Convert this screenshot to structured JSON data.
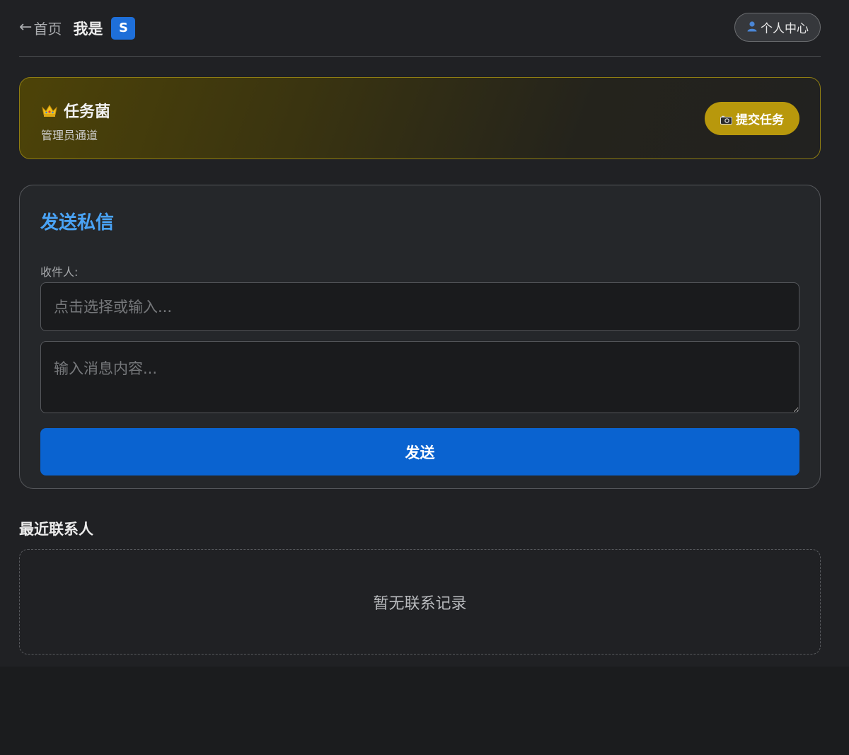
{
  "header": {
    "back_arrow": "←",
    "back_label": "首页",
    "me_label": "我是",
    "avatar_letter": "S",
    "user_center_label": "个人中心",
    "user_center_icon": "person-icon"
  },
  "task_banner": {
    "icon": "crown-icon",
    "title": "任务菌",
    "subtitle": "管理员通道",
    "submit_label": "提交任务",
    "submit_icon": "camera-icon"
  },
  "message_form": {
    "title": "发送私信",
    "recipient_label": "收件人:",
    "recipient_placeholder": "点击选择或输入...",
    "recipient_value": "",
    "content_placeholder": "输入消息内容...",
    "content_value": "",
    "send_label": "发送"
  },
  "recent_contacts": {
    "title": "最近联系人",
    "empty_text": "暂无联系记录"
  },
  "colors": {
    "accent_blue": "#0a63d0",
    "title_blue": "#4aa3f5",
    "gold": "#b8980c"
  }
}
